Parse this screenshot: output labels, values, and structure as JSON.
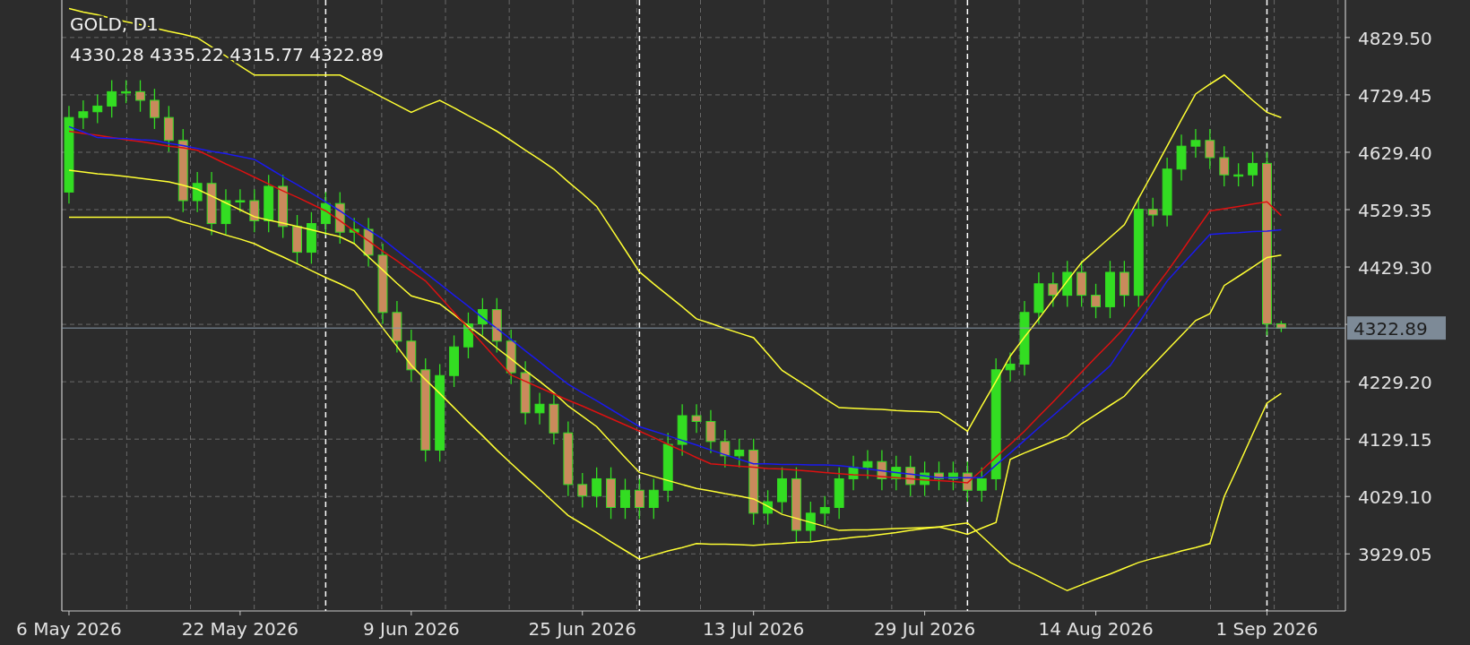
{
  "chart_data": {
    "type": "candlestick",
    "title": "GOLD, D1",
    "grid": true,
    "ylim": [
      3829.5,
      4894.9
    ],
    "yticks": [
      {
        "value": 3929.05,
        "label": "3929.05"
      },
      {
        "value": 4029.1,
        "label": "4029.10"
      },
      {
        "value": 4129.15,
        "label": "4129.15"
      },
      {
        "value": 4229.2,
        "label": "4229.20"
      },
      {
        "value": 4429.3,
        "label": "4429.30"
      },
      {
        "value": 4529.35,
        "label": "4529.35"
      },
      {
        "value": 4629.4,
        "label": "4629.40"
      },
      {
        "value": 4729.45,
        "label": "4729.45"
      },
      {
        "value": 4829.5,
        "label": "4829.50"
      }
    ],
    "categories": [
      "6 May 2026",
      null,
      null,
      null,
      null,
      null,
      null,
      null,
      null,
      null,
      null,
      null,
      "22 May 2026",
      null,
      null,
      null,
      null,
      null,
      null,
      null,
      null,
      null,
      null,
      null,
      "9 Jun 2026",
      null,
      null,
      null,
      null,
      null,
      null,
      null,
      null,
      null,
      null,
      null,
      "25 Jun 2026",
      null,
      null,
      null,
      null,
      null,
      null,
      null,
      null,
      null,
      null,
      null,
      "13 Jul 2026",
      null,
      null,
      null,
      null,
      null,
      null,
      null,
      null,
      null,
      null,
      null,
      "29 Jul 2026",
      null,
      null,
      null,
      null,
      null,
      null,
      null,
      null,
      null,
      null,
      null,
      "14 Aug 2026",
      null,
      null,
      null,
      null,
      null,
      null,
      null,
      null,
      null,
      null,
      null,
      "1 Sep 2026",
      null,
      null,
      null,
      null,
      null
    ],
    "ohlc": [
      [
        4560,
        4710,
        4540,
        4690
      ],
      [
        4690,
        4720,
        4670,
        4700
      ],
      [
        4700,
        4730,
        4680,
        4710
      ],
      [
        4710,
        4755,
        4690,
        4735
      ],
      [
        4735,
        4755,
        4715,
        4735
      ],
      [
        4735,
        4755,
        4700,
        4720
      ],
      [
        4720,
        4740,
        4670,
        4690
      ],
      [
        4690,
        4710,
        4630,
        4650
      ],
      [
        4650,
        4670,
        4525,
        4545
      ],
      [
        4545,
        4595,
        4525,
        4575
      ],
      [
        4575,
        4595,
        4485,
        4505
      ],
      [
        4505,
        4565,
        4485,
        4545
      ],
      [
        4545,
        4565,
        4525,
        4545
      ],
      [
        4545,
        4565,
        4490,
        4510
      ],
      [
        4510,
        4590,
        4490,
        4570
      ],
      [
        4570,
        4590,
        4480,
        4500
      ],
      [
        4500,
        4520,
        4435,
        4455
      ],
      [
        4455,
        4525,
        4435,
        4505
      ],
      [
        4505,
        4560,
        4485,
        4540
      ],
      [
        4540,
        4560,
        4470,
        4490
      ],
      [
        4490,
        4515,
        4470,
        4495
      ],
      [
        4495,
        4515,
        4430,
        4450
      ],
      [
        4450,
        4470,
        4330,
        4350
      ],
      [
        4350,
        4370,
        4280,
        4300
      ],
      [
        4300,
        4320,
        4230,
        4250
      ],
      [
        4250,
        4270,
        4090,
        4110
      ],
      [
        4110,
        4260,
        4090,
        4240
      ],
      [
        4240,
        4310,
        4220,
        4290
      ],
      [
        4290,
        4350,
        4270,
        4330
      ],
      [
        4330,
        4375,
        4310,
        4355
      ],
      [
        4355,
        4375,
        4280,
        4300
      ],
      [
        4300,
        4320,
        4225,
        4245
      ],
      [
        4245,
        4265,
        4155,
        4175
      ],
      [
        4175,
        4210,
        4155,
        4190
      ],
      [
        4190,
        4210,
        4120,
        4140
      ],
      [
        4140,
        4160,
        4030,
        4050
      ],
      [
        4050,
        4070,
        4010,
        4030
      ],
      [
        4030,
        4080,
        4010,
        4060
      ],
      [
        4060,
        4080,
        3990,
        4010
      ],
      [
        4010,
        4060,
        3990,
        4040
      ],
      [
        4040,
        4060,
        3990,
        4010
      ],
      [
        4010,
        4060,
        3990,
        4040
      ],
      [
        4040,
        4140,
        4020,
        4120
      ],
      [
        4120,
        4190,
        4100,
        4170
      ],
      [
        4170,
        4190,
        4140,
        4160
      ],
      [
        4160,
        4180,
        4105,
        4125
      ],
      [
        4125,
        4145,
        4080,
        4100
      ],
      [
        4100,
        4130,
        4080,
        4110
      ],
      [
        4110,
        4130,
        3980,
        4000
      ],
      [
        4000,
        4040,
        3980,
        4020
      ],
      [
        4020,
        4080,
        4000,
        4060
      ],
      [
        4060,
        4080,
        3950,
        3970
      ],
      [
        3970,
        4020,
        3950,
        4000
      ],
      [
        4000,
        4030,
        3980,
        4010
      ],
      [
        4010,
        4080,
        3990,
        4060
      ],
      [
        4060,
        4100,
        4040,
        4080
      ],
      [
        4080,
        4110,
        4060,
        4090
      ],
      [
        4090,
        4110,
        4040,
        4060
      ],
      [
        4060,
        4100,
        4040,
        4080
      ],
      [
        4080,
        4100,
        4030,
        4050
      ],
      [
        4050,
        4090,
        4030,
        4070
      ],
      [
        4070,
        4090,
        4040,
        4060
      ],
      [
        4060,
        4090,
        4040,
        4070
      ],
      [
        4070,
        4090,
        4020,
        4040
      ],
      [
        4040,
        4080,
        4020,
        4060
      ],
      [
        4060,
        4270,
        4040,
        4250
      ],
      [
        4250,
        4280,
        4230,
        4260
      ],
      [
        4260,
        4370,
        4240,
        4350
      ],
      [
        4350,
        4420,
        4330,
        4400
      ],
      [
        4400,
        4420,
        4360,
        4380
      ],
      [
        4380,
        4440,
        4360,
        4420
      ],
      [
        4420,
        4440,
        4360,
        4380
      ],
      [
        4380,
        4400,
        4340,
        4360
      ],
      [
        4360,
        4440,
        4340,
        4420
      ],
      [
        4420,
        4440,
        4360,
        4380
      ],
      [
        4380,
        4550,
        4360,
        4530
      ],
      [
        4530,
        4550,
        4500,
        4520
      ],
      [
        4520,
        4620,
        4500,
        4600
      ],
      [
        4600,
        4660,
        4580,
        4640
      ],
      [
        4640,
        4670,
        4620,
        4650
      ],
      [
        4650,
        4670,
        4600,
        4620
      ],
      [
        4620,
        4640,
        4570,
        4590
      ],
      [
        4590,
        4610,
        4570,
        4590
      ],
      [
        4590,
        4630,
        4570,
        4610
      ],
      [
        4610,
        4630,
        4310,
        4330
      ],
      [
        4330.28,
        4335.22,
        4315.77,
        4322.89
      ],
      null,
      null,
      null,
      null
    ],
    "series": [
      {
        "type": "line",
        "color": "#ffff33",
        "values": [
          4880,
          4874,
          4869,
          4863,
          4857,
          4852,
          4846,
          4840,
          4835,
          4829,
          4813,
          4797,
          4780,
          4764,
          4764,
          4764,
          4764,
          4764,
          4764,
          4764,
          4751,
          4738,
          4725,
          4712,
          4699,
          4710,
          4720,
          4707,
          4693,
          4680,
          4666,
          4650,
          4633,
          4617,
          4600,
          4578,
          4557,
          4535,
          4497,
          4459,
          4421,
          4400,
          4380,
          4360,
          4339,
          4331,
          4322,
          4314,
          4306,
          4278,
          4249,
          4233,
          4217,
          4200,
          4184,
          4183,
          4182,
          4181,
          4179,
          4178,
          4177,
          4176,
          4160,
          4143,
          4187,
          4230,
          4274,
          4307,
          4339,
          4372,
          4405,
          4437,
          4459,
          4481,
          4503,
          4549,
          4594,
          4640,
          4686,
          4731,
          4748,
          4764,
          4742,
          4720,
          4699,
          4690,
          null,
          null,
          null,
          null
        ]
      },
      {
        "type": "line",
        "color": "#ffff33",
        "values": [
          4516,
          4516,
          4516,
          4516,
          4516,
          4516,
          4516,
          4516,
          4508,
          4501,
          4493,
          4485,
          4478,
          4470,
          4458,
          4447,
          4435,
          4423,
          4411,
          4400,
          4388,
          4356,
          4323,
          4291,
          4258,
          4233,
          4209,
          4184,
          4159,
          4135,
          4110,
          4087,
          4064,
          4042,
          4019,
          3996,
          3981,
          3966,
          3950,
          3935,
          3920,
          3927,
          3934,
          3940,
          3947,
          3946,
          3946,
          3945,
          3944,
          3946,
          3947,
          3949,
          3950,
          3953,
          3955,
          3958,
          3960,
          3963,
          3966,
          3970,
          3973,
          3976,
          3980,
          3983,
          3960,
          3937,
          3914,
          3902,
          3890,
          3877,
          3865,
          3875,
          3885,
          3894,
          3904,
          3914,
          3921,
          3927,
          3934,
          3940,
          3947,
          4029,
          4083,
          4138,
          4192,
          4209,
          null,
          null,
          null,
          null
        ]
      },
      {
        "type": "line",
        "color": "#ffff33",
        "values": [
          4598,
          4595,
          4592,
          4590,
          4587,
          4584,
          4581,
          4578,
          4572,
          4565,
          4553,
          4541,
          4529,
          4517,
          4511,
          4506,
          4500,
          4494,
          4488,
          4482,
          4470,
          4447,
          4424,
          4401,
          4379,
          4372,
          4365,
          4346,
          4326,
          4308,
          4288,
          4269,
          4249,
          4230,
          4210,
          4187,
          4169,
          4151,
          4124,
          4097,
          4071,
          4064,
          4057,
          4050,
          4043,
          4039,
          4034,
          4030,
          4025,
          4012,
          3998,
          3991,
          3984,
          3977,
          3970,
          3971,
          3971,
          3972,
          3973,
          3974,
          3975,
          3976,
          3970,
          3963,
          3974,
          3984,
          4094,
          4105,
          4115,
          4125,
          4135,
          4156,
          4172,
          4188,
          4204,
          4232,
          4258,
          4284,
          4310,
          4336,
          4348,
          4397,
          4413,
          4429,
          4446,
          4450,
          null,
          null,
          null,
          null
        ]
      },
      {
        "type": "line",
        "color": "#dd1111",
        "values": [
          4666,
          4662,
          4659,
          4655,
          4651,
          4648,
          4644,
          4640,
          4637,
          4633,
          4621,
          4609,
          4598,
          4586,
          4574,
          4562,
          4551,
          4539,
          4527,
          4510,
          4492,
          4475,
          4457,
          4440,
          4422,
          4405,
          4378,
          4350,
          4323,
          4296,
          4268,
          4241,
          4230,
          4219,
          4208,
          4197,
          4187,
          4176,
          4165,
          4154,
          4143,
          4132,
          4120,
          4109,
          4097,
          4086,
          4084,
          4082,
          4080,
          4078,
          4077,
          4075,
          4073,
          4071,
          4069,
          4067,
          4066,
          4064,
          4062,
          4060,
          4058,
          4057,
          4055,
          4053,
          4075,
          4098,
          4120,
          4143,
          4169,
          4194,
          4220,
          4246,
          4272,
          4297,
          4323,
          4356,
          4388,
          4421,
          4456,
          4492,
          4527,
          4531,
          4535,
          4539,
          4543,
          4519,
          null,
          null,
          null,
          null
        ]
      },
      {
        "type": "line",
        "color": "#1a1aee",
        "values": [
          4674,
          4665,
          4655,
          4654,
          4653,
          4651,
          4650,
          4645,
          4641,
          4636,
          4631,
          4627,
          4622,
          4617,
          4602,
          4587,
          4573,
          4558,
          4543,
          4527,
          4510,
          4494,
          4478,
          4458,
          4439,
          4419,
          4400,
          4380,
          4361,
          4341,
          4322,
          4303,
          4283,
          4264,
          4244,
          4225,
          4210,
          4196,
          4181,
          4166,
          4151,
          4143,
          4135,
          4127,
          4119,
          4110,
          4102,
          4094,
          4086,
          4086,
          4085,
          4085,
          4084,
          4084,
          4083,
          4080,
          4077,
          4074,
          4071,
          4068,
          4065,
          4062,
          4062,
          4062,
          4062,
          4084,
          4105,
          4127,
          4149,
          4170,
          4192,
          4214,
          4235,
          4257,
          4294,
          4331,
          4368,
          4405,
          4432,
          4459,
          4486,
          4488,
          4489,
          4491,
          4492,
          4494,
          null,
          null,
          null,
          null
        ]
      }
    ],
    "ref_lines": [
      {
        "axis": "y",
        "value": 4322.89,
        "label": "4322.89"
      }
    ]
  },
  "ohlc_readout": "4330.28 4335.22 4315.77 4322.89"
}
